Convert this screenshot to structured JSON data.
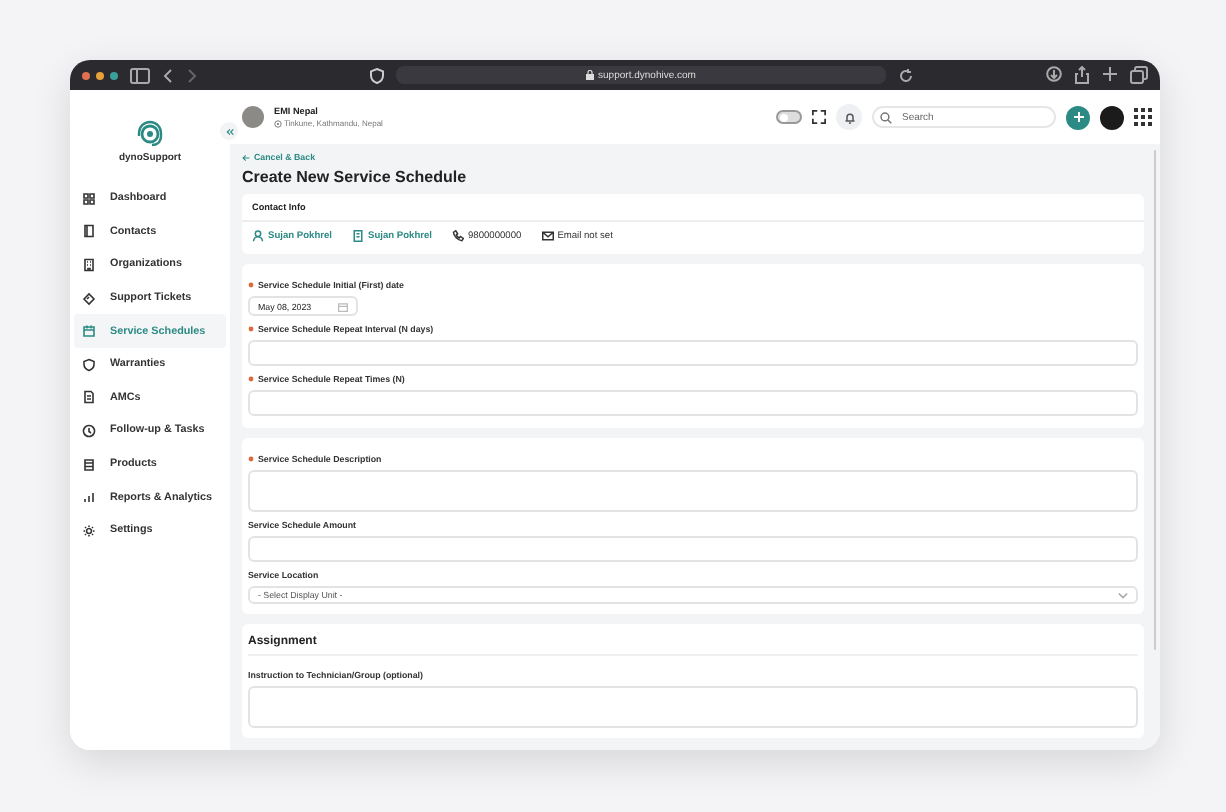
{
  "browser": {
    "url": "support.dynohive.com"
  },
  "sidebar": {
    "logo": "dynoSupport",
    "items": [
      {
        "label": "Dashboard",
        "selected": false
      },
      {
        "label": "Contacts",
        "selected": false
      },
      {
        "label": "Organizations",
        "selected": false
      },
      {
        "label": "Support Tickets",
        "selected": false
      },
      {
        "label": "Service Schedules",
        "selected": true
      },
      {
        "label": "Warranties",
        "selected": false
      },
      {
        "label": "AMCs",
        "selected": false
      },
      {
        "label": "Follow-up & Tasks",
        "selected": false
      },
      {
        "label": "Products",
        "selected": false
      },
      {
        "label": "Reports & Analytics",
        "selected": false
      },
      {
        "label": "Settings",
        "selected": false
      }
    ]
  },
  "header": {
    "name": "EMI Nepal",
    "location": "Tinkune, Kathmandu, Nepal",
    "theme_toggle": {
      "on": false
    },
    "search": {
      "placeholder": "Search"
    }
  },
  "back_link": "Cancel & Back",
  "title": "Create New Service Schedule",
  "contact_info": {
    "heading": "Contact Info",
    "items": [
      {
        "kind": "person",
        "text": "Sujan Pokhrel"
      },
      {
        "kind": "organization",
        "text": "Sujan Pokhrel"
      },
      {
        "kind": "phone",
        "text": "9800000000"
      },
      {
        "kind": "email",
        "text": "Email not set"
      }
    ]
  },
  "sections": [
    {
      "fields": [
        {
          "label": "Service Schedule Initial (First) date",
          "required": true,
          "kind": "date",
          "value": "May 08, 2023"
        },
        {
          "label": "Service Schedule Repeat Interval (N days)",
          "required": true,
          "kind": "text"
        },
        {
          "label": "Service Schedule Repeat Times (N)",
          "required": true,
          "kind": "text"
        }
      ]
    },
    {
      "fields": [
        {
          "label": "Service Schedule Description",
          "required": true,
          "kind": "textarea"
        },
        {
          "label": "Service Schedule Amount",
          "required": false,
          "kind": "text"
        },
        {
          "label": "Service Location",
          "required": false,
          "kind": "select",
          "placeholder": "- Select Display Unit -"
        }
      ]
    },
    {
      "heading": "Assignment",
      "fields": [
        {
          "label": "Instruction to Technician/Group (optional)",
          "required": false,
          "kind": "textarea"
        }
      ]
    }
  ]
}
